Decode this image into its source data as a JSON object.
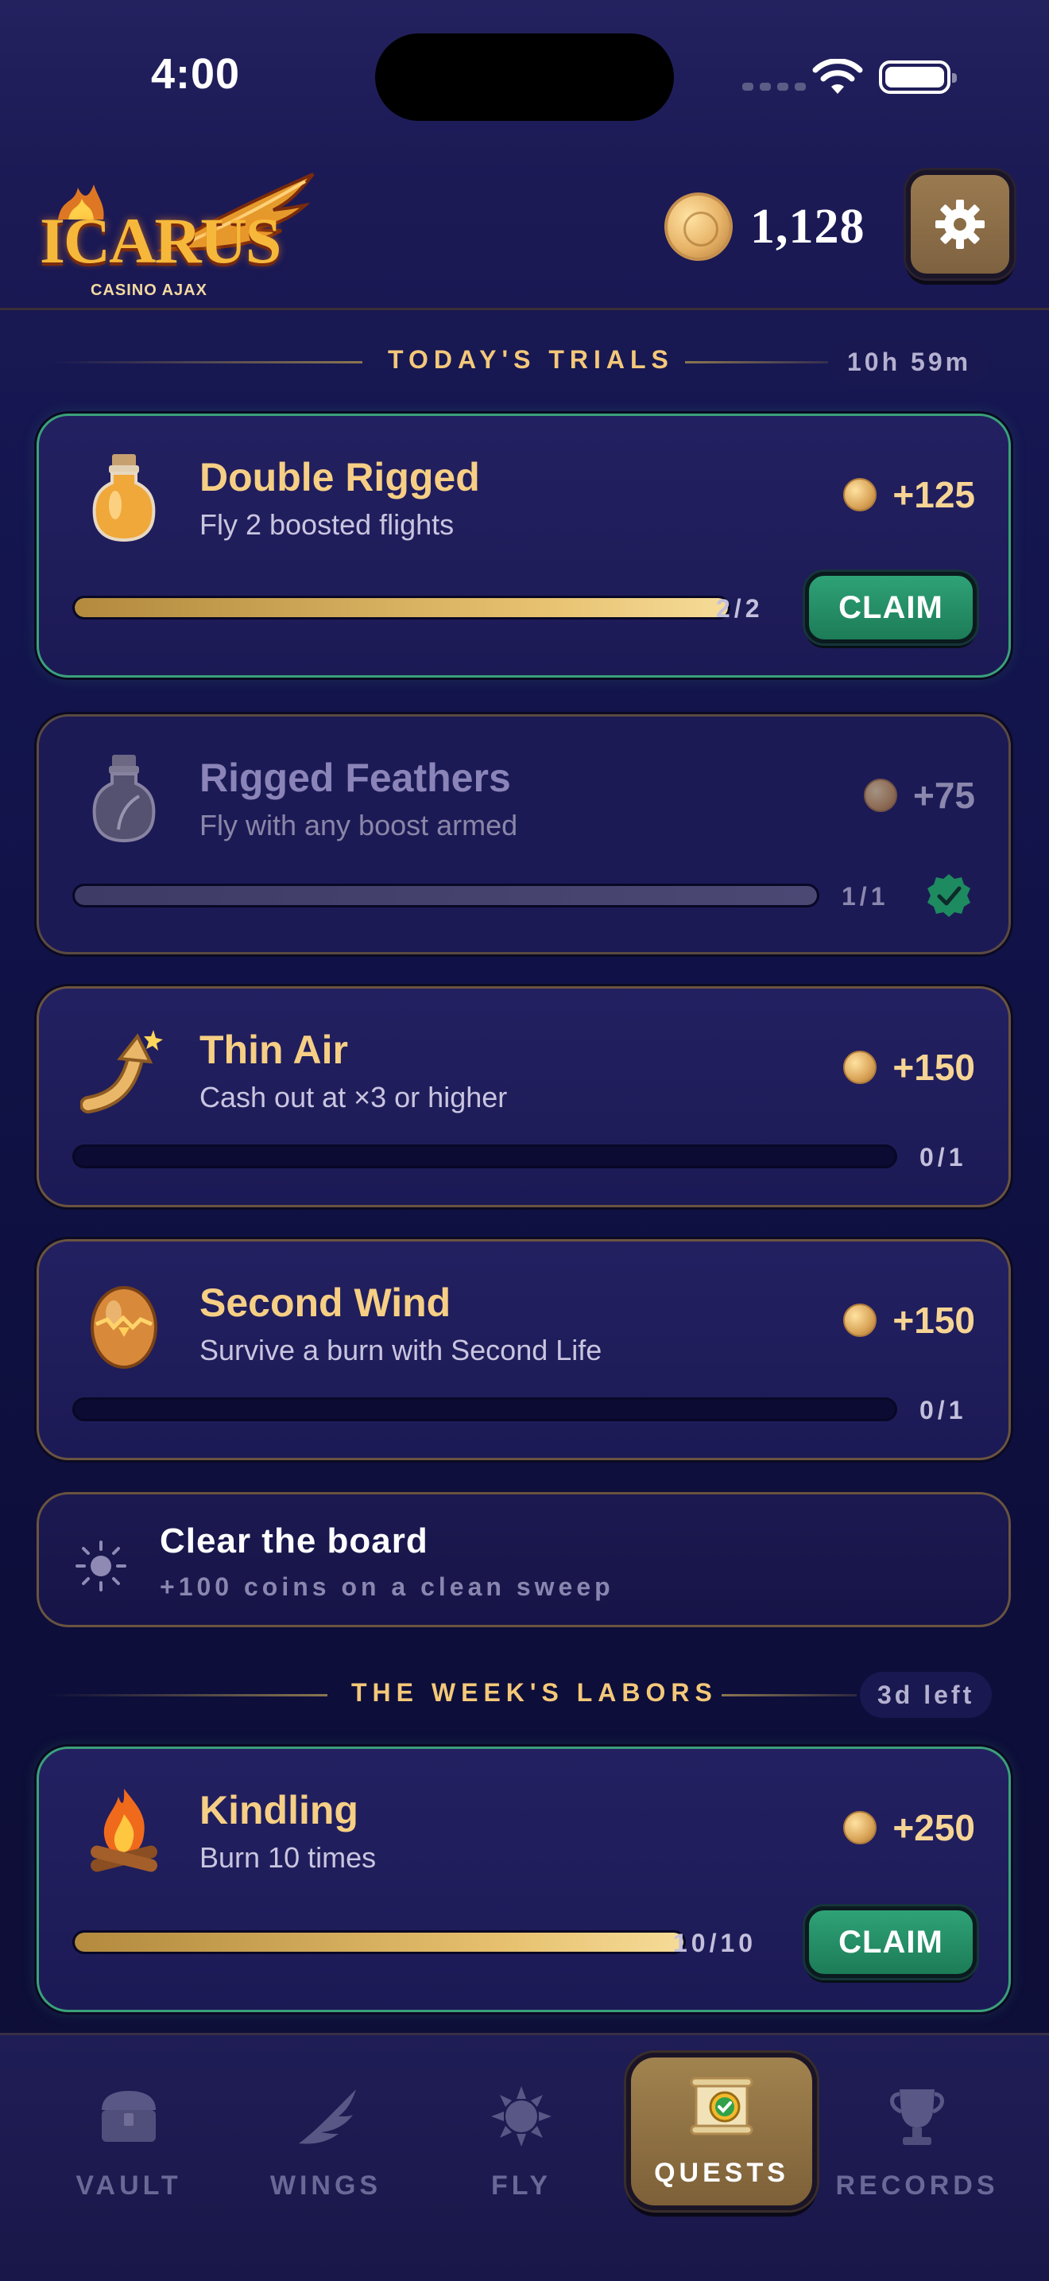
{
  "status_bar": {
    "time": "4:00"
  },
  "header": {
    "logo_text": "ICARUS",
    "logo_sub": "CASINO AJAX",
    "coin_balance": "1,128",
    "settings_icon": "gear-icon"
  },
  "daily": {
    "title": "TODAY'S TRIALS",
    "timer": "10h 59m",
    "quests": [
      {
        "title": "Double Rigged",
        "desc": "Fly 2 boosted flights",
        "reward": "+125",
        "progress_text": "2/2",
        "progress": 1.0,
        "state": "claimable",
        "icon": "potion-bottle-icon"
      },
      {
        "title": "Rigged Feathers",
        "desc": "Fly with any boost armed",
        "reward": "+75",
        "progress_text": "1/1",
        "progress": 1.0,
        "state": "completed",
        "icon": "feather-bottle-icon"
      },
      {
        "title": "Thin Air",
        "desc": "Cash out at ×3 or higher",
        "reward": "+150",
        "progress_text": "0/1",
        "progress": 0.0,
        "state": "in-progress",
        "icon": "rising-arrow-icon"
      },
      {
        "title": "Second Wind",
        "desc": "Survive a burn with Second Life",
        "reward": "+150",
        "progress_text": "0/1",
        "progress": 0.0,
        "state": "in-progress",
        "icon": "cracked-egg-icon"
      }
    ],
    "claim_label": "CLAIM"
  },
  "board": {
    "title": "Clear the board",
    "subtitle": "+100 coins on a clean sweep"
  },
  "weekly": {
    "title": "THE WEEK'S LABORS",
    "timer": "3d left",
    "quests": [
      {
        "title": "Kindling",
        "desc": "Burn 10 times",
        "reward": "+250",
        "progress_text": "10/10",
        "progress": 1.0,
        "state": "claimable",
        "icon": "campfire-icon"
      }
    ]
  },
  "tabs": [
    {
      "label": "VAULT",
      "icon": "treasure-chest-icon",
      "active": false
    },
    {
      "label": "WINGS",
      "icon": "wing-icon",
      "active": false
    },
    {
      "label": "FLY",
      "icon": "sun-icon",
      "active": false
    },
    {
      "label": "QUESTS",
      "icon": "scroll-icon",
      "active": true
    },
    {
      "label": "RECORDS",
      "icon": "trophy-icon",
      "active": false
    }
  ],
  "colors": {
    "accent_gold": "#f6cf84",
    "claim_green": "#2fa277",
    "background": "#101246"
  }
}
